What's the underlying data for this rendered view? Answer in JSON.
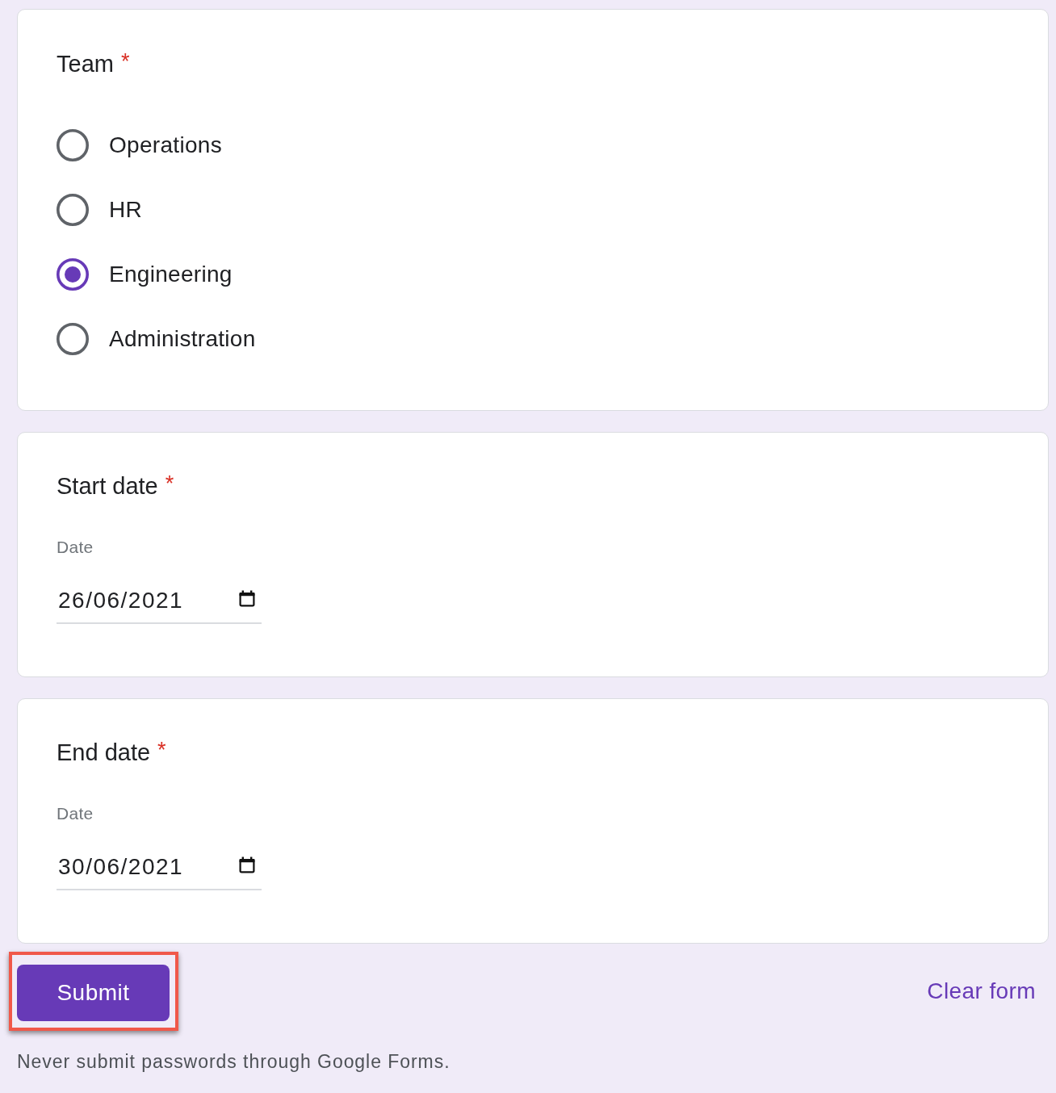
{
  "questions": [
    {
      "kind": "radio",
      "title": "Team",
      "required_mark": "*",
      "options": [
        {
          "label": "Operations",
          "selected": false
        },
        {
          "label": "HR",
          "selected": false
        },
        {
          "label": "Engineering",
          "selected": true
        },
        {
          "label": "Administration",
          "selected": false
        }
      ]
    },
    {
      "kind": "date",
      "title": "Start date",
      "required_mark": "*",
      "field_label": "Date",
      "value": "26/06/2021"
    },
    {
      "kind": "date",
      "title": "End date",
      "required_mark": "*",
      "field_label": "Date",
      "value": "30/06/2021"
    }
  ],
  "actions": {
    "submit": {
      "label": "Submit",
      "highlighted": true
    },
    "clear": {
      "label": "Clear form"
    }
  },
  "footer": "Never submit passwords through Google Forms."
}
